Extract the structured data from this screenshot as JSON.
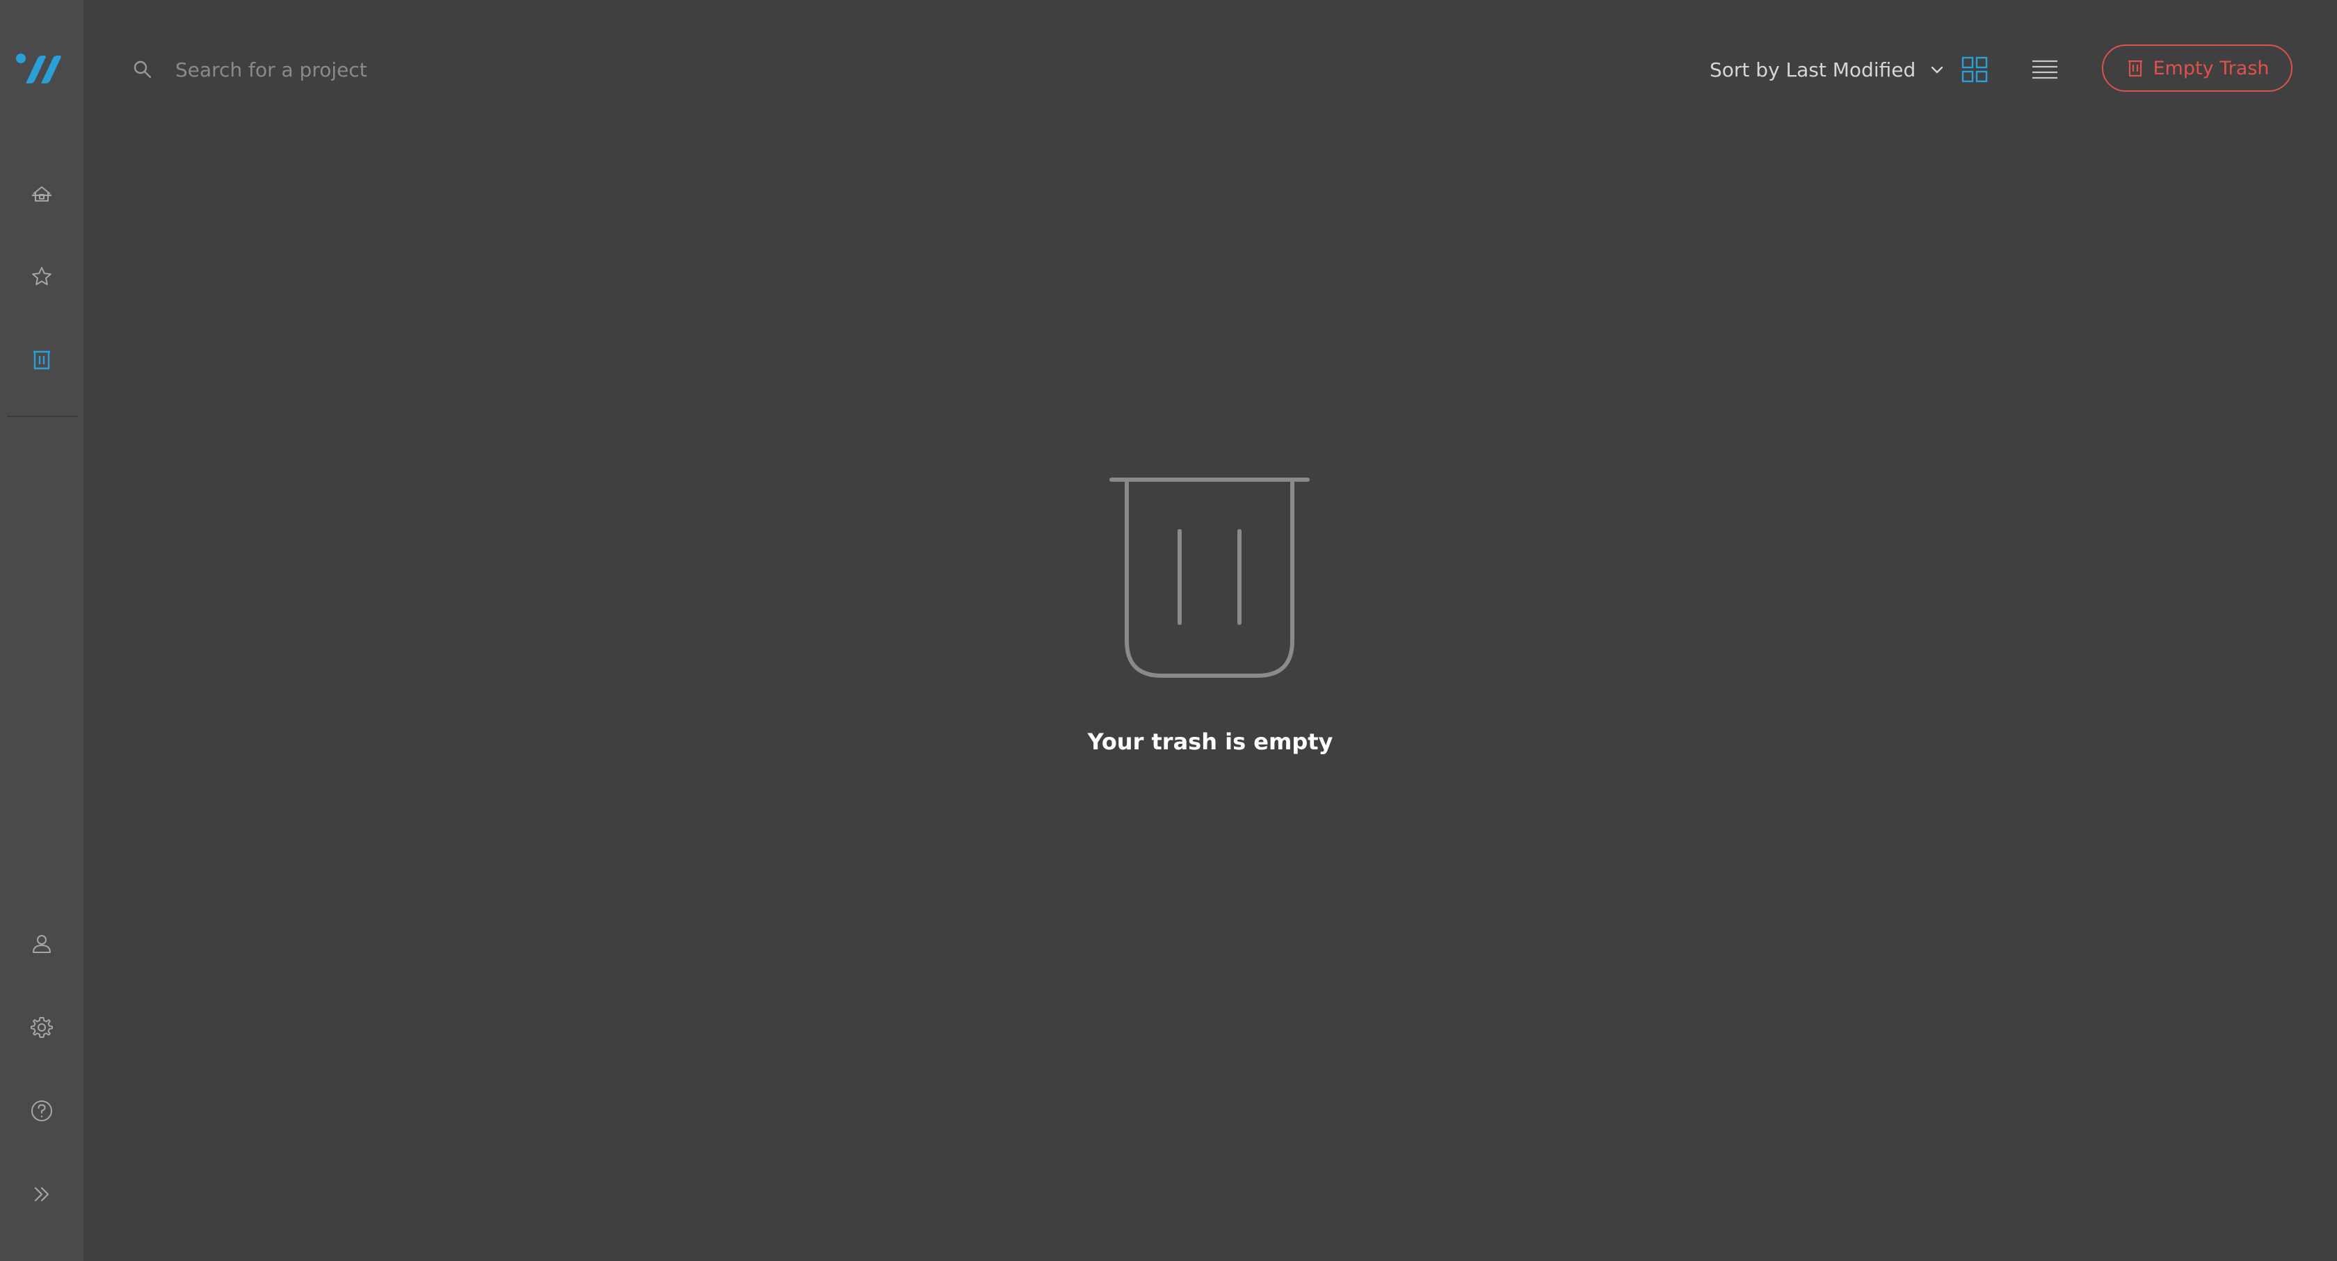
{
  "colors": {
    "background": "#404040",
    "sidebar": "#4a4a4a",
    "accent_blue": "#2b9fd8",
    "danger_red": "#e0504c",
    "icon_gray": "#a6a6a6"
  },
  "sidebar": {
    "logo": "app-logo",
    "items": [
      {
        "icon": "home-icon",
        "active": false
      },
      {
        "icon": "star-icon",
        "active": false
      },
      {
        "icon": "trash-icon",
        "active": true
      }
    ],
    "bottom_items": [
      {
        "icon": "user-icon"
      },
      {
        "icon": "gear-icon"
      },
      {
        "icon": "help-icon"
      },
      {
        "icon": "expand-icon"
      }
    ]
  },
  "search": {
    "placeholder": "Search for a project",
    "value": ""
  },
  "toolbar": {
    "sort_label": "Sort by Last Modified",
    "view_mode": "grid",
    "empty_trash_label": "Empty Trash"
  },
  "empty_state": {
    "message": "Your trash is empty"
  }
}
